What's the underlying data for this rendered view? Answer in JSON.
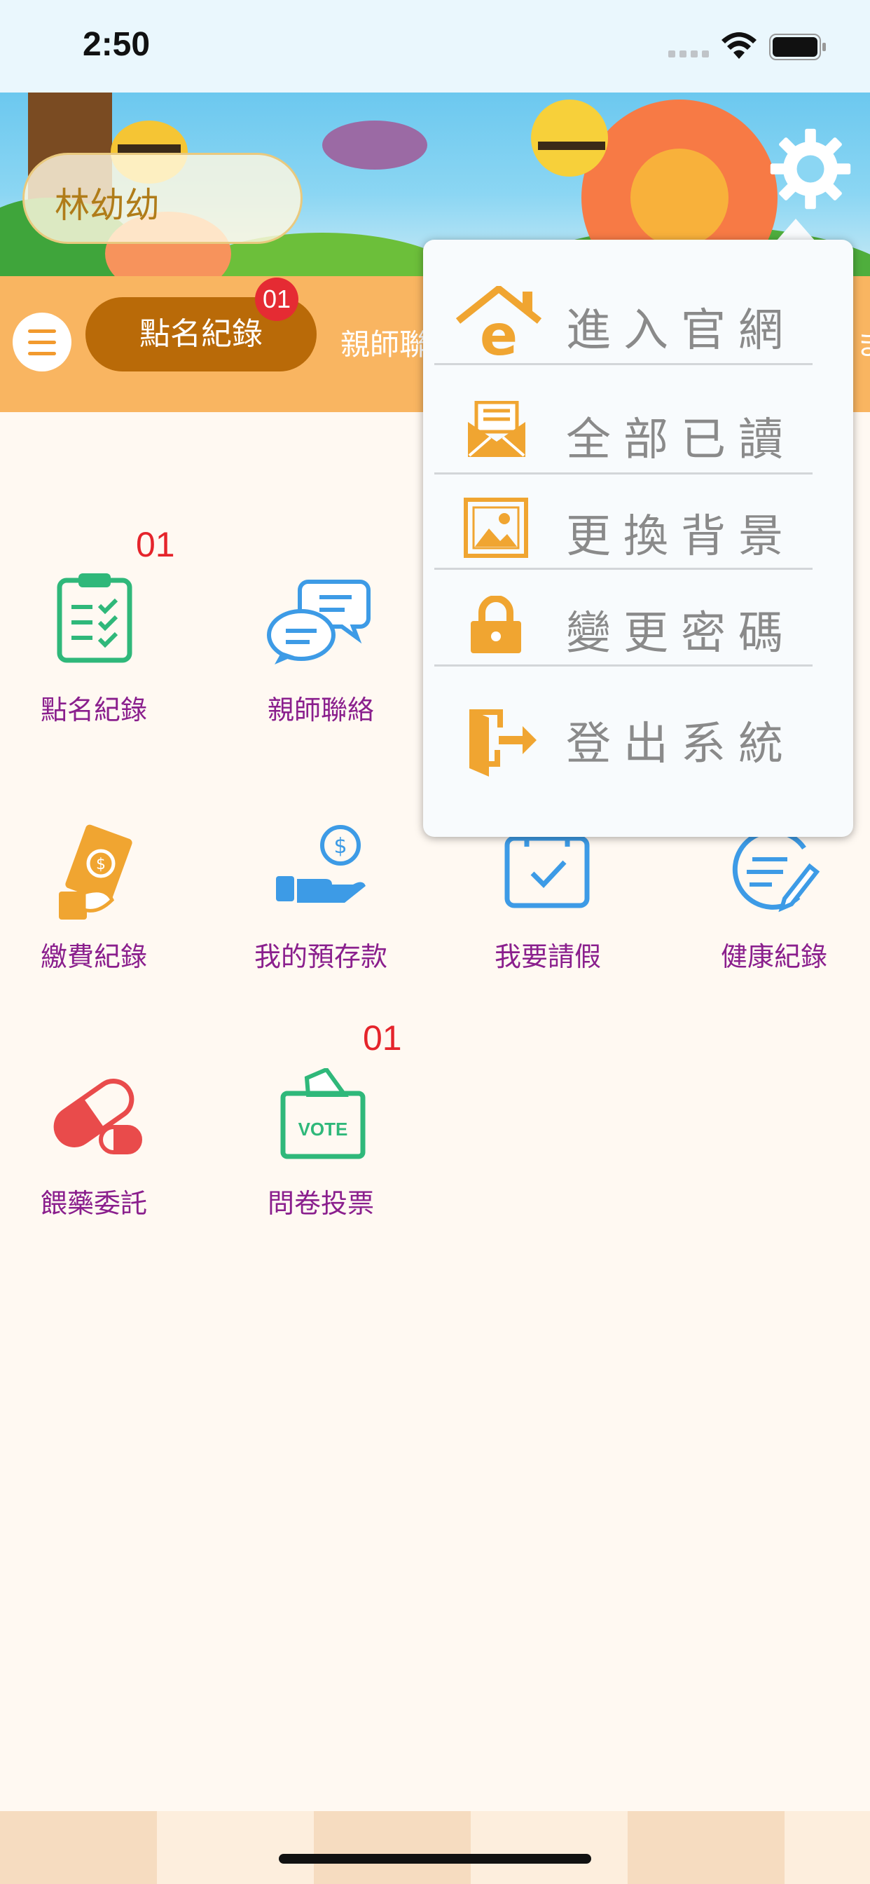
{
  "status_bar": {
    "time": "2:50"
  },
  "header": {
    "child_name": "林幼幼"
  },
  "tabs": {
    "active": {
      "label": "點名紀錄",
      "badge": "01"
    },
    "next_label_partial": "親師聯",
    "edge_label_partial": "ま"
  },
  "grid": {
    "row1": [
      {
        "label": "點名紀錄",
        "badge": "01",
        "icon": "clipboard-checklist-icon"
      },
      {
        "label": "親師聯絡",
        "icon": "chat-bubbles-icon"
      }
    ],
    "row2": [
      {
        "label": "繳費紀錄",
        "icon": "payment-icon"
      },
      {
        "label": "我的預存款",
        "icon": "hand-coin-icon"
      },
      {
        "label": "我要請假",
        "icon": "calendar-check-icon"
      },
      {
        "label": "健康紀錄",
        "icon": "health-record-icon"
      }
    ],
    "row3": [
      {
        "label": "餵藥委託",
        "icon": "pill-icon"
      },
      {
        "label": "問卷投票",
        "badge": "01",
        "icon": "vote-box-icon",
        "icon_text": "VOTE"
      }
    ]
  },
  "dropdown": {
    "items": [
      {
        "label": "進入官網",
        "icon": "home-web-icon"
      },
      {
        "label": "全部已讀",
        "icon": "mail-read-icon"
      },
      {
        "label": "更換背景",
        "icon": "image-icon"
      },
      {
        "label": "變更密碼",
        "icon": "lock-icon"
      },
      {
        "label": "登出系統",
        "icon": "logout-door-icon"
      }
    ]
  },
  "colors": {
    "accent_orange": "#f0a531",
    "tab_strip": "#f9b561",
    "active_tab": "#b96a08",
    "badge_red": "#e52b33",
    "label_purple": "#8a1f8d",
    "green_icon": "#2fb87a",
    "blue_icon": "#3d9be6"
  }
}
